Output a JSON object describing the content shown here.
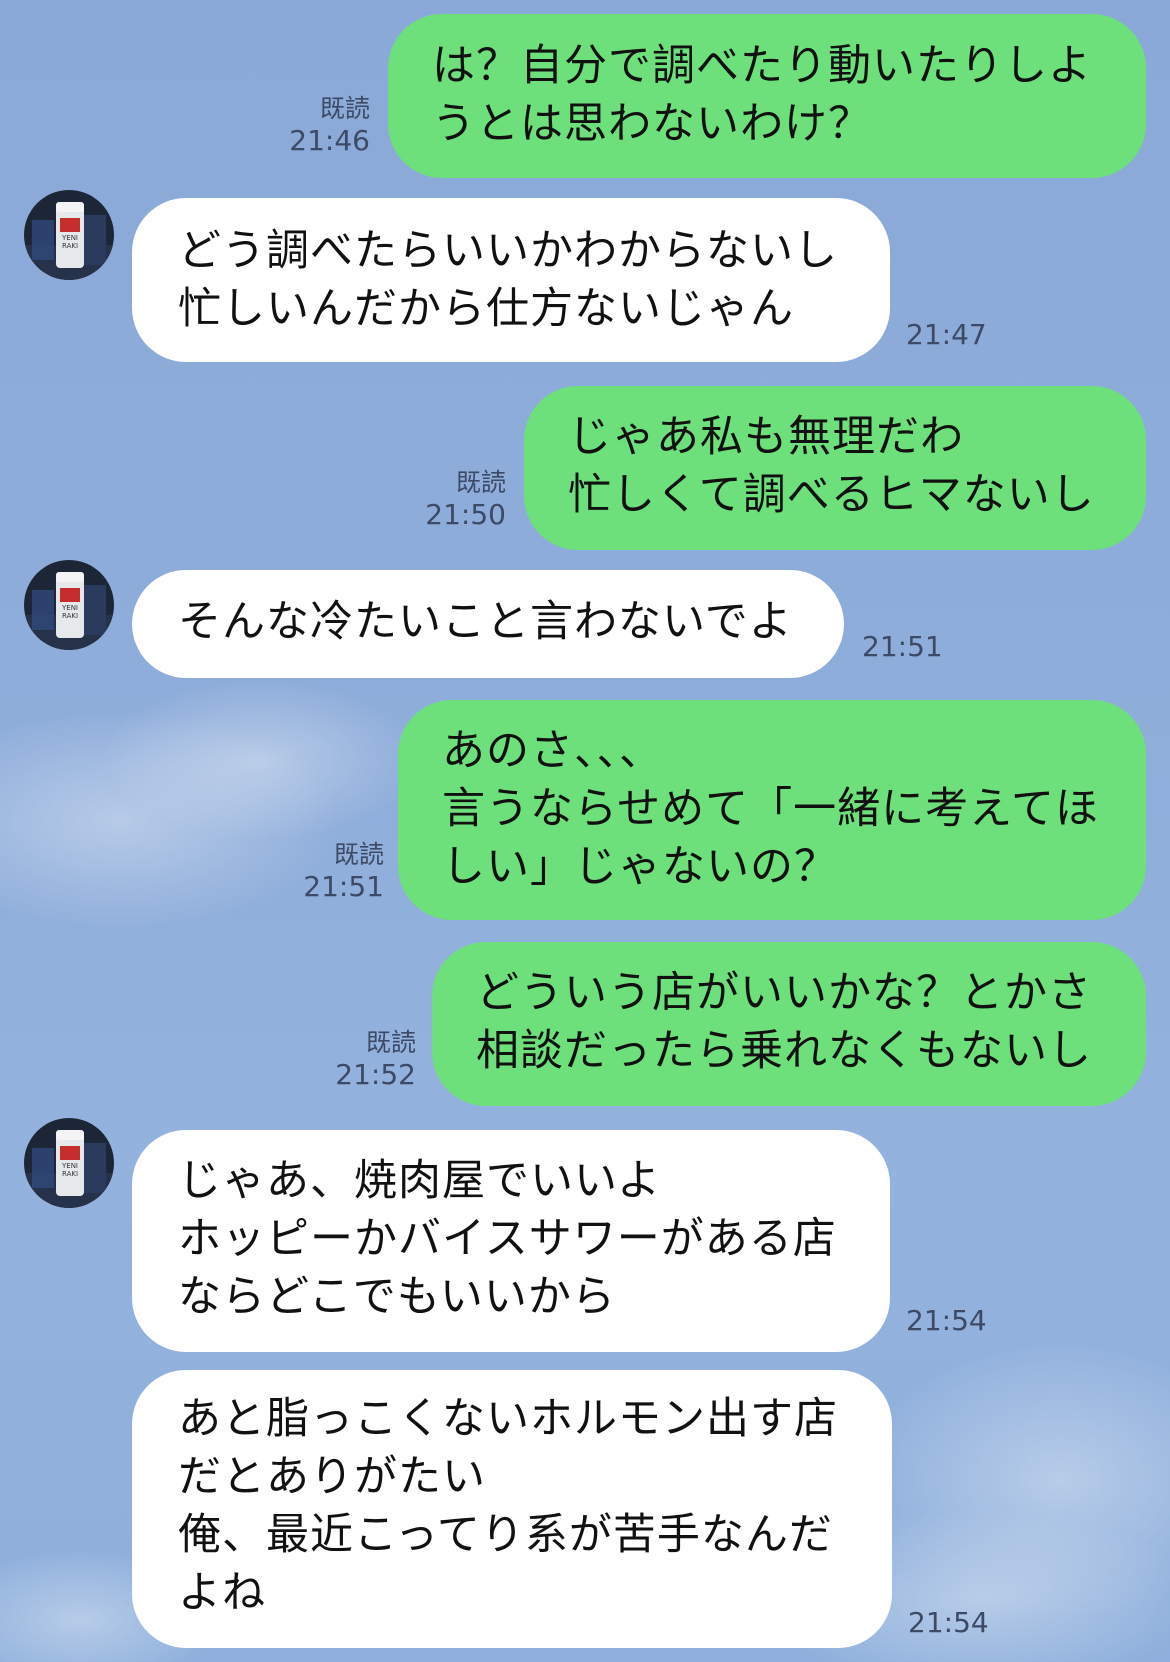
{
  "messages": [
    {
      "side": "mine",
      "lines": [
        "は？自分で調べたり動いたりしよ",
        "うとは思わないわけ？"
      ],
      "read": "既読",
      "time": "21:46"
    },
    {
      "side": "theirs",
      "lines": [
        "どう調べたらいいかわからないし",
        "忙しいんだから仕方ないじゃん"
      ],
      "time": "21:47"
    },
    {
      "side": "mine",
      "lines": [
        "じゃあ私も無理だわ",
        "忙しくて調べるヒマないし"
      ],
      "read": "既読",
      "time": "21:50"
    },
    {
      "side": "theirs",
      "lines": [
        "そんな冷たいこと言わないでよ"
      ],
      "time": "21:51"
    },
    {
      "side": "mine",
      "lines": [
        "あのさ、、、",
        "言うならせめて「一緒に考えてほ",
        "しい」じゃないの？"
      ],
      "read": "既読",
      "time": "21:51"
    },
    {
      "side": "mine",
      "lines": [
        "どういう店がいいかな？とかさ",
        "相談だったら乗れなくもないし"
      ],
      "read": "既読",
      "time": "21:52"
    },
    {
      "side": "theirs",
      "lines": [
        "じゃあ、焼肉屋でいいよ",
        "ホッピーかバイスサワーがある店",
        "ならどこでもいいから"
      ],
      "time": "21:54"
    },
    {
      "side": "theirs",
      "lines": [
        "あと脂っこくないホルモン出す店",
        "だとありがたい",
        "俺、最近こってり系が苦手なんだ",
        "よね"
      ],
      "time": "21:54"
    }
  ],
  "avatar_text": [
    "YENI",
    "RAKI"
  ],
  "colors": {
    "background": "#8eadda",
    "mine_bubble": "#6ee07b",
    "theirs_bubble": "#ffffff"
  }
}
